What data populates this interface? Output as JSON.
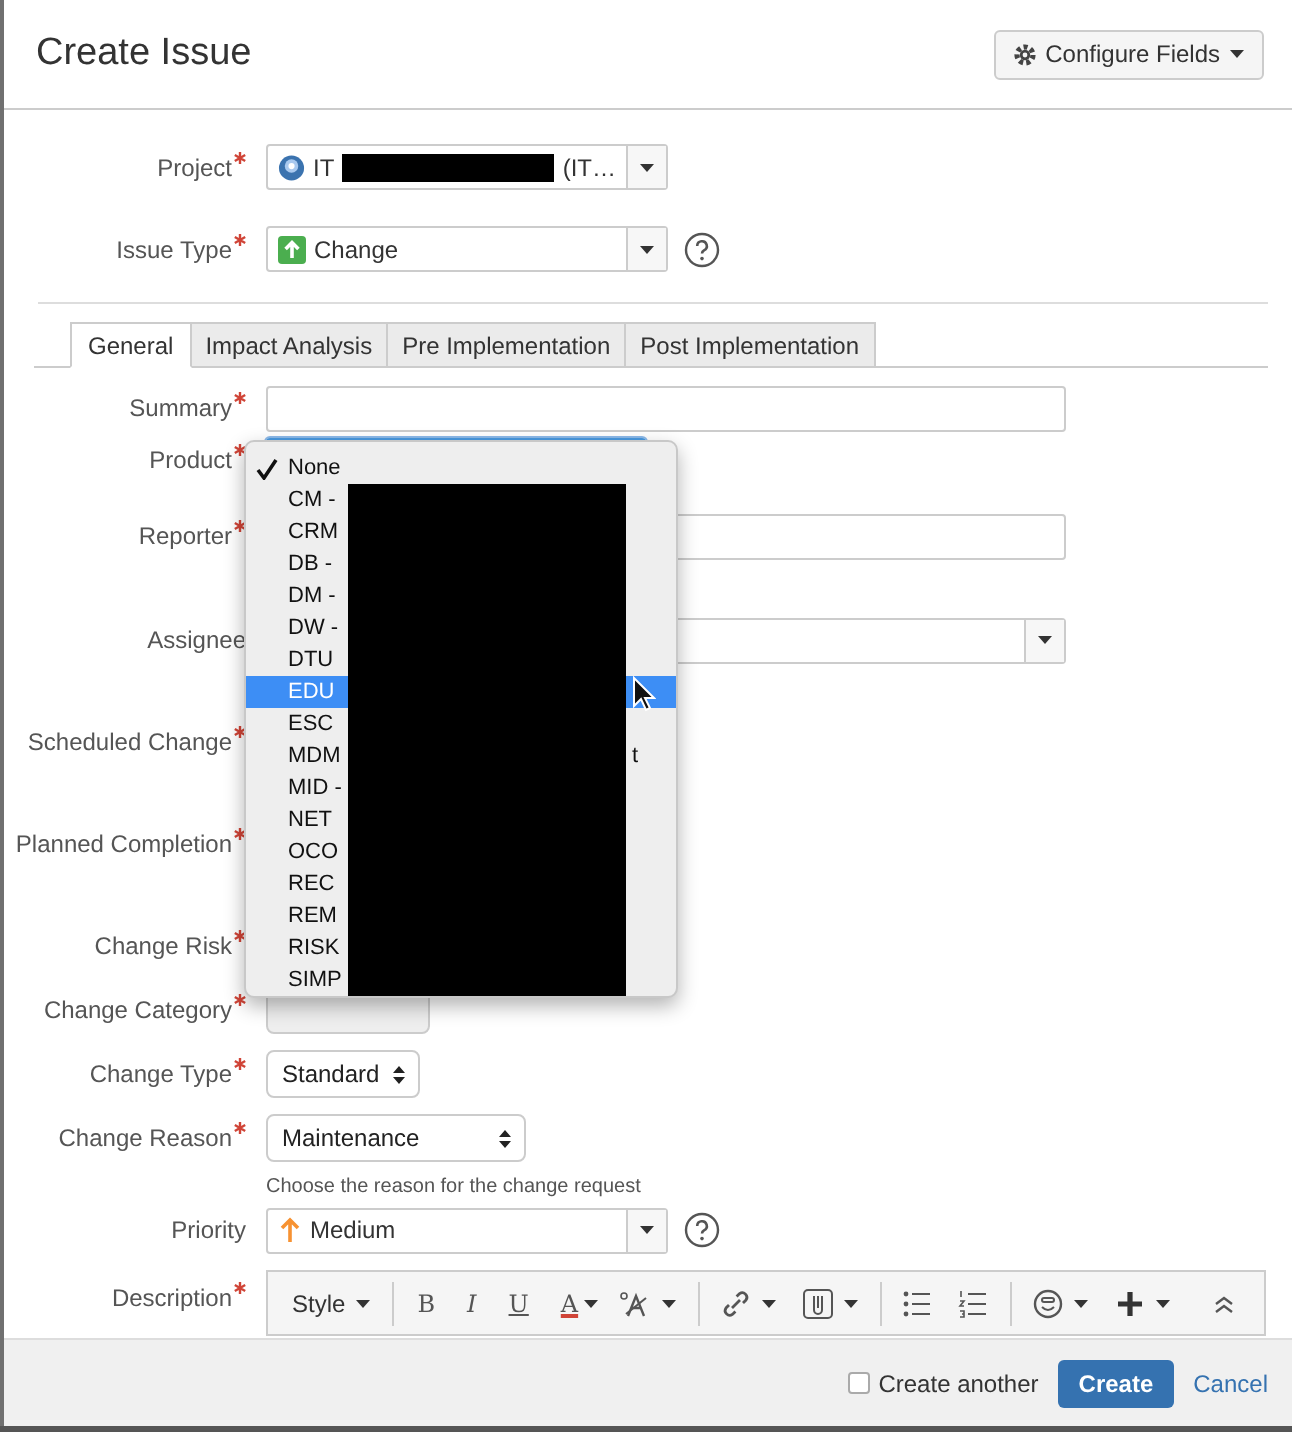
{
  "dialog": {
    "title": "Create Issue",
    "configure_button": "Configure Fields"
  },
  "top_fields": [
    {
      "label": "Project",
      "required": true,
      "kind": "project",
      "value": "IT",
      "value_tail": "(IT…",
      "redacted": true
    },
    {
      "label": "Issue Type",
      "required": true,
      "kind": "issuetype",
      "value": "Change",
      "help": true
    }
  ],
  "tabs": [
    {
      "label": "General",
      "selected": true
    },
    {
      "label": "Impact Analysis",
      "selected": false
    },
    {
      "label": "Pre Implementation",
      "selected": false
    },
    {
      "label": "Post Implementation",
      "selected": false
    }
  ],
  "fields": [
    {
      "label": "Summary",
      "required": true,
      "kind": "text"
    },
    {
      "label": "Product",
      "required": true,
      "kind": "focused"
    },
    {
      "label": "Reporter",
      "required": true,
      "kind": "text"
    },
    {
      "label": "Assignee",
      "required": false,
      "kind": "picker"
    },
    {
      "label": "Scheduled Change",
      "required": true,
      "kind": "hidden"
    },
    {
      "label": "Planned Completion",
      "required": true,
      "kind": "hidden"
    },
    {
      "label": "Change Risk",
      "required": true,
      "kind": "hidden"
    },
    {
      "label": "Change Category",
      "required": true,
      "kind": "select"
    },
    {
      "label": "Change Type",
      "required": true,
      "kind": "select",
      "value": "Standard"
    },
    {
      "label": "Change Reason",
      "required": true,
      "kind": "select",
      "value": "Maintenance",
      "hint": "Choose the reason for the change request"
    },
    {
      "label": "Priority",
      "required": false,
      "kind": "priority",
      "value": "Medium",
      "help": true
    },
    {
      "label": "Description",
      "required": true,
      "kind": "editor"
    }
  ],
  "editor_toolbar": [
    {
      "kind": "style",
      "label": "Style"
    },
    {
      "kind": "sep"
    },
    {
      "kind": "bold",
      "label": "B"
    },
    {
      "kind": "italic",
      "label": "I"
    },
    {
      "kind": "underline",
      "label": "U"
    },
    {
      "kind": "color",
      "label": "A"
    },
    {
      "kind": "fontsize"
    },
    {
      "kind": "sep"
    },
    {
      "kind": "link"
    },
    {
      "kind": "attach"
    },
    {
      "kind": "sep"
    },
    {
      "kind": "bullets"
    },
    {
      "kind": "numbers"
    },
    {
      "kind": "sep"
    },
    {
      "kind": "emoji"
    },
    {
      "kind": "plus"
    },
    {
      "kind": "collapse"
    }
  ],
  "dropdown": {
    "items": [
      {
        "label": "None",
        "selected": true,
        "highlighted": false,
        "redacted": false
      },
      {
        "label": "CM -",
        "selected": false,
        "highlighted": false,
        "redacted": true
      },
      {
        "label": "CRM",
        "selected": false,
        "highlighted": false,
        "redacted": true
      },
      {
        "label": "DB -",
        "selected": false,
        "highlighted": false,
        "redacted": true
      },
      {
        "label": "DM -",
        "selected": false,
        "highlighted": false,
        "redacted": true
      },
      {
        "label": "DW -",
        "selected": false,
        "highlighted": false,
        "redacted": true
      },
      {
        "label": "DTU",
        "selected": false,
        "highlighted": false,
        "redacted": true
      },
      {
        "label": "EDU",
        "selected": false,
        "highlighted": true,
        "redacted": true
      },
      {
        "label": "ESC",
        "selected": false,
        "highlighted": false,
        "redacted": true
      },
      {
        "label": "MDM",
        "tail": "t",
        "selected": false,
        "highlighted": false,
        "redacted": true
      },
      {
        "label": "MID -",
        "selected": false,
        "highlighted": false,
        "redacted": true
      },
      {
        "label": "NET",
        "selected": false,
        "highlighted": false,
        "redacted": true
      },
      {
        "label": "OCO",
        "selected": false,
        "highlighted": false,
        "redacted": true
      },
      {
        "label": "REC",
        "selected": false,
        "highlighted": false,
        "redacted": true
      },
      {
        "label": "REM",
        "selected": false,
        "highlighted": false,
        "redacted": true
      },
      {
        "label": "RISK",
        "selected": false,
        "highlighted": false,
        "redacted": true
      },
      {
        "label": "SIMP",
        "selected": false,
        "highlighted": false,
        "redacted": true
      }
    ]
  },
  "footer": {
    "create_another": {
      "label": "Create another",
      "checked": false
    },
    "submit": "Create",
    "cancel": "Cancel"
  }
}
